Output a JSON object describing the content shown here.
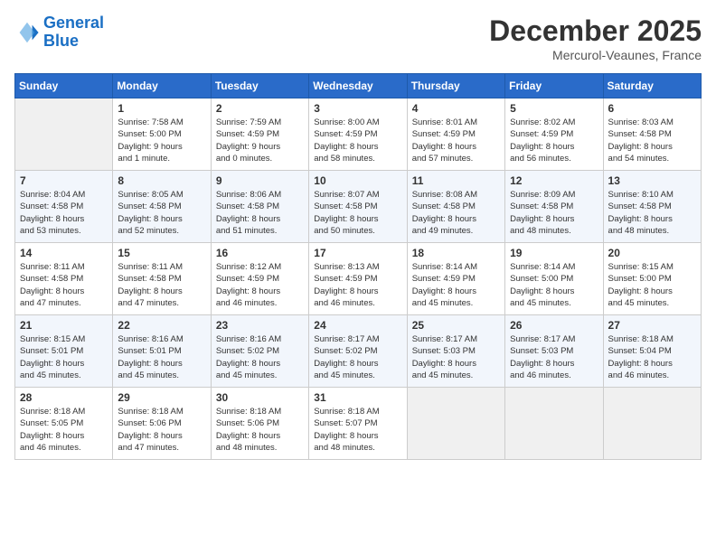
{
  "logo": {
    "text_general": "General",
    "text_blue": "Blue"
  },
  "title": "December 2025",
  "subtitle": "Mercurol-Veaunes, France",
  "days_of_week": [
    "Sunday",
    "Monday",
    "Tuesday",
    "Wednesday",
    "Thursday",
    "Friday",
    "Saturday"
  ],
  "weeks": [
    [
      {
        "num": "",
        "info": ""
      },
      {
        "num": "1",
        "info": "Sunrise: 7:58 AM\nSunset: 5:00 PM\nDaylight: 9 hours\nand 1 minute."
      },
      {
        "num": "2",
        "info": "Sunrise: 7:59 AM\nSunset: 4:59 PM\nDaylight: 9 hours\nand 0 minutes."
      },
      {
        "num": "3",
        "info": "Sunrise: 8:00 AM\nSunset: 4:59 PM\nDaylight: 8 hours\nand 58 minutes."
      },
      {
        "num": "4",
        "info": "Sunrise: 8:01 AM\nSunset: 4:59 PM\nDaylight: 8 hours\nand 57 minutes."
      },
      {
        "num": "5",
        "info": "Sunrise: 8:02 AM\nSunset: 4:59 PM\nDaylight: 8 hours\nand 56 minutes."
      },
      {
        "num": "6",
        "info": "Sunrise: 8:03 AM\nSunset: 4:58 PM\nDaylight: 8 hours\nand 54 minutes."
      }
    ],
    [
      {
        "num": "7",
        "info": "Sunrise: 8:04 AM\nSunset: 4:58 PM\nDaylight: 8 hours\nand 53 minutes."
      },
      {
        "num": "8",
        "info": "Sunrise: 8:05 AM\nSunset: 4:58 PM\nDaylight: 8 hours\nand 52 minutes."
      },
      {
        "num": "9",
        "info": "Sunrise: 8:06 AM\nSunset: 4:58 PM\nDaylight: 8 hours\nand 51 minutes."
      },
      {
        "num": "10",
        "info": "Sunrise: 8:07 AM\nSunset: 4:58 PM\nDaylight: 8 hours\nand 50 minutes."
      },
      {
        "num": "11",
        "info": "Sunrise: 8:08 AM\nSunset: 4:58 PM\nDaylight: 8 hours\nand 49 minutes."
      },
      {
        "num": "12",
        "info": "Sunrise: 8:09 AM\nSunset: 4:58 PM\nDaylight: 8 hours\nand 48 minutes."
      },
      {
        "num": "13",
        "info": "Sunrise: 8:10 AM\nSunset: 4:58 PM\nDaylight: 8 hours\nand 48 minutes."
      }
    ],
    [
      {
        "num": "14",
        "info": "Sunrise: 8:11 AM\nSunset: 4:58 PM\nDaylight: 8 hours\nand 47 minutes."
      },
      {
        "num": "15",
        "info": "Sunrise: 8:11 AM\nSunset: 4:58 PM\nDaylight: 8 hours\nand 47 minutes."
      },
      {
        "num": "16",
        "info": "Sunrise: 8:12 AM\nSunset: 4:59 PM\nDaylight: 8 hours\nand 46 minutes."
      },
      {
        "num": "17",
        "info": "Sunrise: 8:13 AM\nSunset: 4:59 PM\nDaylight: 8 hours\nand 46 minutes."
      },
      {
        "num": "18",
        "info": "Sunrise: 8:14 AM\nSunset: 4:59 PM\nDaylight: 8 hours\nand 45 minutes."
      },
      {
        "num": "19",
        "info": "Sunrise: 8:14 AM\nSunset: 5:00 PM\nDaylight: 8 hours\nand 45 minutes."
      },
      {
        "num": "20",
        "info": "Sunrise: 8:15 AM\nSunset: 5:00 PM\nDaylight: 8 hours\nand 45 minutes."
      }
    ],
    [
      {
        "num": "21",
        "info": "Sunrise: 8:15 AM\nSunset: 5:01 PM\nDaylight: 8 hours\nand 45 minutes."
      },
      {
        "num": "22",
        "info": "Sunrise: 8:16 AM\nSunset: 5:01 PM\nDaylight: 8 hours\nand 45 minutes."
      },
      {
        "num": "23",
        "info": "Sunrise: 8:16 AM\nSunset: 5:02 PM\nDaylight: 8 hours\nand 45 minutes."
      },
      {
        "num": "24",
        "info": "Sunrise: 8:17 AM\nSunset: 5:02 PM\nDaylight: 8 hours\nand 45 minutes."
      },
      {
        "num": "25",
        "info": "Sunrise: 8:17 AM\nSunset: 5:03 PM\nDaylight: 8 hours\nand 45 minutes."
      },
      {
        "num": "26",
        "info": "Sunrise: 8:17 AM\nSunset: 5:03 PM\nDaylight: 8 hours\nand 46 minutes."
      },
      {
        "num": "27",
        "info": "Sunrise: 8:18 AM\nSunset: 5:04 PM\nDaylight: 8 hours\nand 46 minutes."
      }
    ],
    [
      {
        "num": "28",
        "info": "Sunrise: 8:18 AM\nSunset: 5:05 PM\nDaylight: 8 hours\nand 46 minutes."
      },
      {
        "num": "29",
        "info": "Sunrise: 8:18 AM\nSunset: 5:06 PM\nDaylight: 8 hours\nand 47 minutes."
      },
      {
        "num": "30",
        "info": "Sunrise: 8:18 AM\nSunset: 5:06 PM\nDaylight: 8 hours\nand 48 minutes."
      },
      {
        "num": "31",
        "info": "Sunrise: 8:18 AM\nSunset: 5:07 PM\nDaylight: 8 hours\nand 48 minutes."
      },
      {
        "num": "",
        "info": ""
      },
      {
        "num": "",
        "info": ""
      },
      {
        "num": "",
        "info": ""
      }
    ]
  ]
}
